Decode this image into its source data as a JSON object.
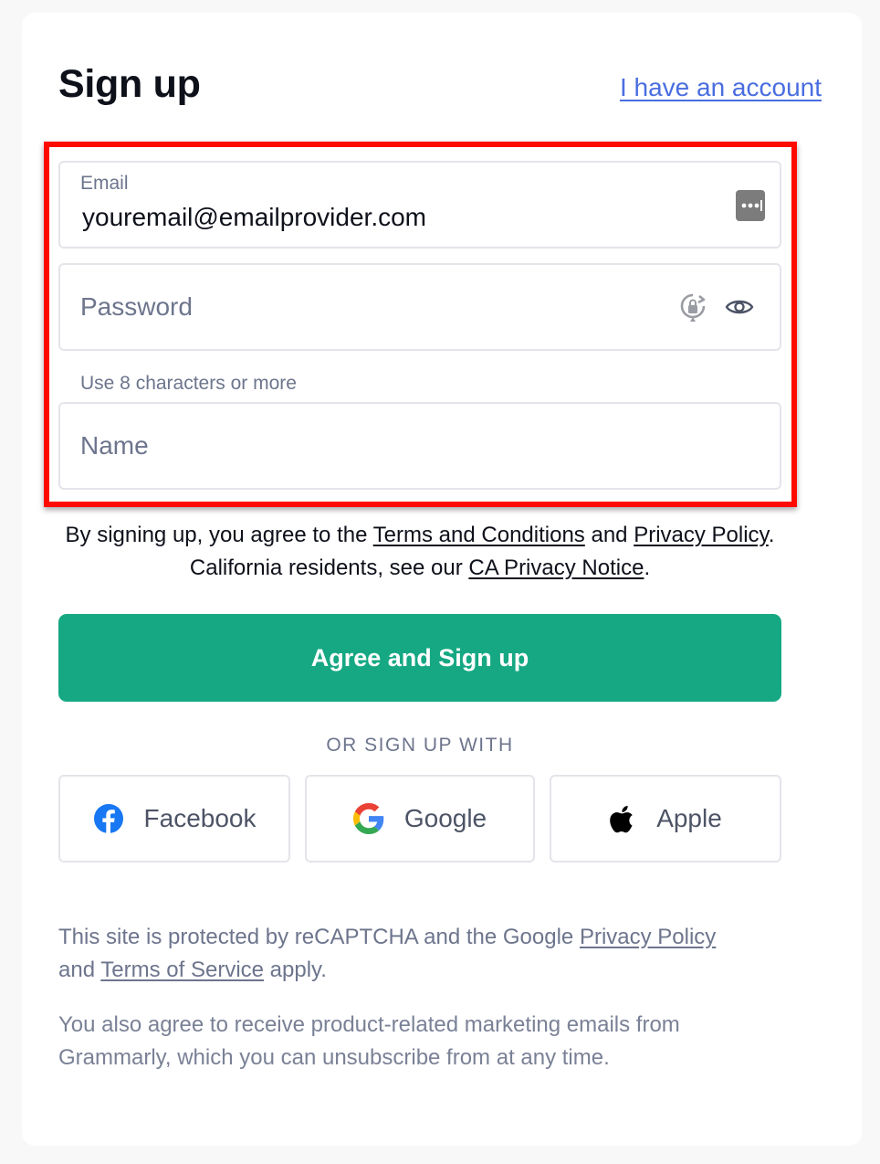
{
  "header": {
    "title": "Sign up",
    "login_link": "I have an account"
  },
  "form": {
    "email": {
      "label": "Email",
      "value": "youremail@emailprovider.com"
    },
    "password": {
      "placeholder": "Password",
      "hint": "Use 8 characters or more"
    },
    "name": {
      "placeholder": "Name"
    }
  },
  "agreement": {
    "prefix": "By signing up, you agree to the ",
    "terms_link": "Terms and Conditions",
    "and": " and ",
    "privacy_link": "Privacy Policy",
    "middle": ". California residents, see our ",
    "ca_link": "CA Privacy Notice",
    "suffix": "."
  },
  "submit_label": "Agree and Sign up",
  "social": {
    "heading": "OR SIGN UP WITH",
    "buttons": [
      {
        "label": "Facebook",
        "icon": "facebook-icon",
        "color": "#1877f2"
      },
      {
        "label": "Google",
        "icon": "google-icon"
      },
      {
        "label": "Apple",
        "icon": "apple-icon",
        "color": "#000000"
      }
    ]
  },
  "footer": {
    "recaptcha_prefix": "This site is protected by reCAPTCHA and the Google ",
    "recaptcha_privacy": "Privacy Policy",
    "recaptcha_and": " and ",
    "recaptcha_terms": "Terms of Service",
    "recaptcha_suffix": " apply.",
    "marketing": "You also agree to receive product-related marketing emails from Grammarly, which you can unsubscribe from at any time."
  },
  "colors": {
    "accent": "#15a883",
    "link": "#4a6ee0",
    "highlight": "#ff0a00"
  }
}
